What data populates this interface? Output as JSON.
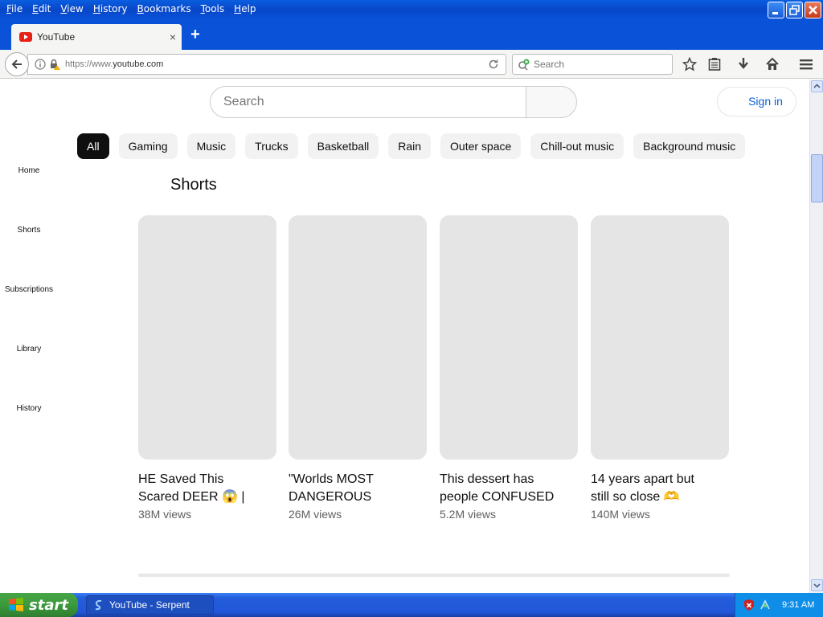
{
  "menubar": {
    "items": [
      {
        "underline": "F",
        "rest": "ile"
      },
      {
        "underline": "E",
        "rest": "dit"
      },
      {
        "underline": "V",
        "rest": "iew"
      },
      {
        "underline": "H",
        "rest": "istory"
      },
      {
        "underline": "B",
        "rest": "ookmarks"
      },
      {
        "underline": "T",
        "rest": "ools"
      },
      {
        "underline": "H",
        "rest": "elp"
      }
    ]
  },
  "tab": {
    "title": "YouTube",
    "close": "×"
  },
  "newtab": "+",
  "urlbar": {
    "prefix": "https://www.",
    "domain": "youtube.com"
  },
  "browser_search": {
    "placeholder": "Search"
  },
  "youtube": {
    "search_placeholder": "Search",
    "sign_in": "Sign in",
    "chips": [
      "All",
      "Gaming",
      "Music",
      "Trucks",
      "Basketball",
      "Rain",
      "Outer space",
      "Chill-out music",
      "Background music"
    ],
    "active_chip": "All",
    "sidenav": [
      "Home",
      "Shorts",
      "Subscriptions",
      "Library",
      "History"
    ],
    "shorts_heading": "Shorts",
    "shorts": [
      {
        "title_line1": "HE Saved This",
        "title_line2": "Scared DEER 😱 |",
        "views": "38M views"
      },
      {
        "title_line1": "\"Worlds MOST",
        "title_line2": "DANGEROUS",
        "views": "26M views"
      },
      {
        "title_line1": "This dessert has",
        "title_line2": "people CONFUSED",
        "views": "5.2M views"
      },
      {
        "title_line1": "14 years apart but",
        "title_line2": "still so close 🫶",
        "views": "140M views"
      }
    ]
  },
  "taskbar": {
    "start": "start",
    "task": "YouTube - Serpent",
    "clock": "9:31 AM"
  },
  "colors": {
    "accent": "#065fd4",
    "chip_active": "#0f0f0f",
    "titlebar": "#0a52d8"
  }
}
